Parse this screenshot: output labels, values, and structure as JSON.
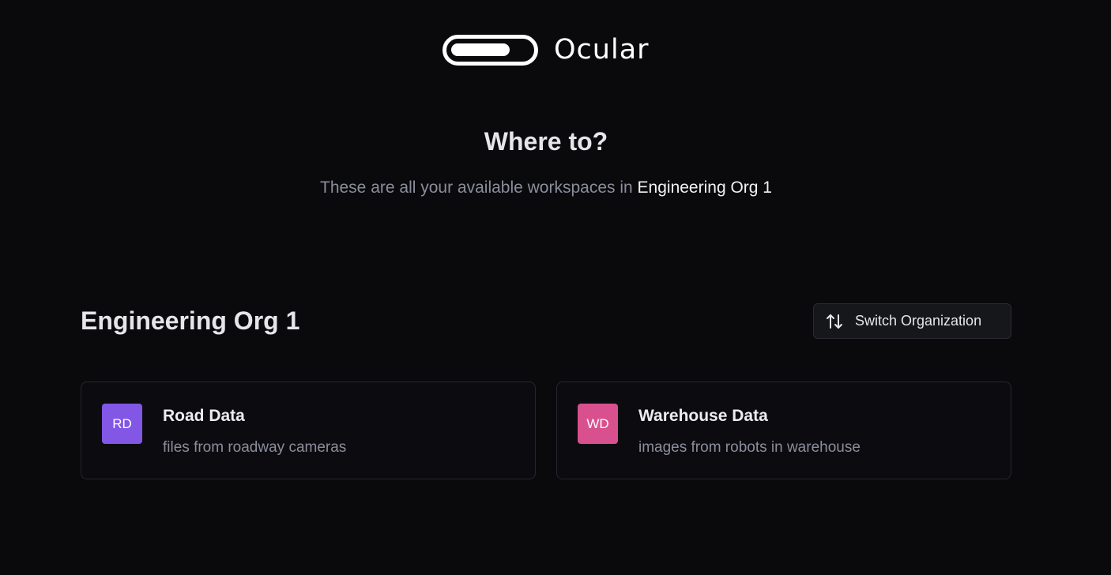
{
  "brand": {
    "name": "Ocular"
  },
  "hero": {
    "title": "Where to?",
    "subtitle_prefix": "These are all your available workspaces in ",
    "subtitle_org": "Engineering Org 1"
  },
  "organization": {
    "name": "Engineering Org 1",
    "switch_label": "Switch Organization",
    "switch_icon": "swap-vertical-arrows-icon"
  },
  "workspaces": [
    {
      "initials": "RD",
      "name": "Road Data",
      "description": "files from roadway cameras",
      "color": "#8257e6"
    },
    {
      "initials": "WD",
      "name": "Warehouse Data",
      "description": "images from robots in warehouse",
      "color": "#d9508f"
    }
  ],
  "colors": {
    "background": "#0a0a0d",
    "muted_text": "#8b8d9c",
    "card_border": "#25262c"
  }
}
